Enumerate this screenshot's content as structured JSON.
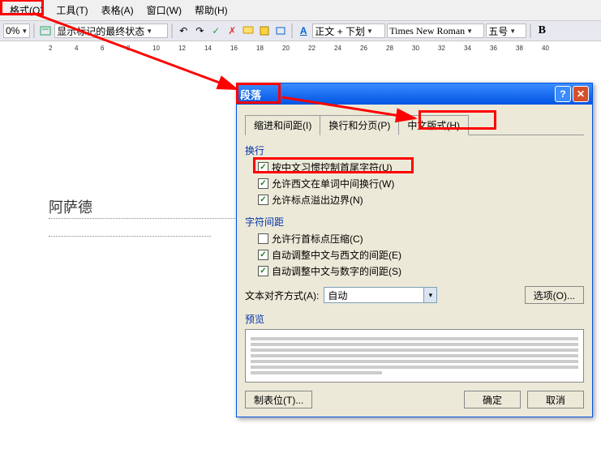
{
  "menubar": {
    "format": "格式(O)",
    "tools": "工具(T)",
    "table": "表格(A)",
    "window": "窗口(W)",
    "help": "帮助(H)"
  },
  "toolbar": {
    "zoom": "0%",
    "markup": "显示标记的最终状态",
    "style": "正文 + 下划",
    "font": "Times New Roman",
    "size": "五号",
    "bold": "B",
    "aa_icon": "A"
  },
  "ruler": {
    "marks": [
      "2",
      "4",
      "6",
      "8",
      "10",
      "12",
      "14",
      "16",
      "18",
      "20",
      "22",
      "24",
      "26",
      "28",
      "30",
      "32",
      "34",
      "36",
      "38",
      "40"
    ]
  },
  "document": {
    "sample_text": "阿萨德"
  },
  "dialog": {
    "title": "段落",
    "tabs": {
      "indent": "缩进和间距(I)",
      "wrap": "换行和分页(P)",
      "asian": "中文版式(H)"
    },
    "section_wrap": "换行",
    "opt1": "按中文习惯控制首尾字符(U)",
    "opt2": "允许西文在单词中间换行(W)",
    "opt3": "允许标点溢出边界(N)",
    "section_char": "字符间距",
    "opt4": "允许行首标点压缩(C)",
    "opt5": "自动调整中文与西文的间距(E)",
    "opt6": "自动调整中文与数字的间距(S)",
    "align_label": "文本对齐方式(A):",
    "align_value": "自动",
    "options_btn": "选项(O)...",
    "section_preview": "预览",
    "tabstops": "制表位(T)...",
    "ok": "确定",
    "cancel": "取消"
  }
}
